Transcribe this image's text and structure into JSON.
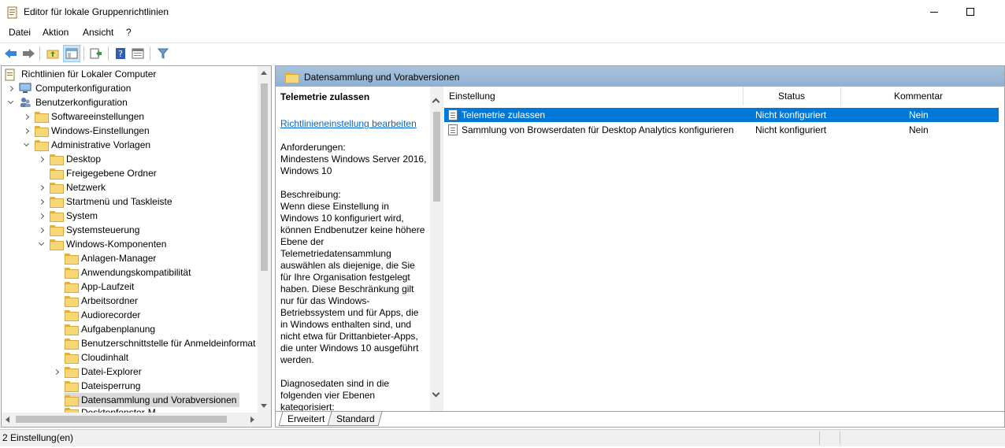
{
  "window": {
    "title": "Editor für lokale Gruppenrichtlinien"
  },
  "menu": [
    "Datei",
    "Aktion",
    "Ansicht",
    "?"
  ],
  "toolbar": {
    "buttons": [
      "back-icon",
      "forward-icon",
      "up-folder-icon",
      "show-hide-tree-icon",
      "export-list-icon",
      "help-icon",
      "properties-view-icon",
      "filter-icon"
    ]
  },
  "tree": {
    "root": "Richtlinien für Lokaler Computer",
    "items": [
      {
        "label": "Computerkonfiguration"
      },
      {
        "label": "Benutzerkonfiguration"
      },
      {
        "label": "Softwareeinstellungen"
      },
      {
        "label": "Windows-Einstellungen"
      },
      {
        "label": "Administrative Vorlagen"
      },
      {
        "label": "Desktop"
      },
      {
        "label": "Freigegebene Ordner"
      },
      {
        "label": "Netzwerk"
      },
      {
        "label": "Startmenü und Taskleiste"
      },
      {
        "label": "System"
      },
      {
        "label": "Systemsteuerung"
      },
      {
        "label": "Windows-Komponenten"
      },
      {
        "label": "Anlagen-Manager"
      },
      {
        "label": "Anwendungskompatibilität"
      },
      {
        "label": "App-Laufzeit"
      },
      {
        "label": "Arbeitsordner"
      },
      {
        "label": "Audiorecorder"
      },
      {
        "label": "Aufgabenplanung"
      },
      {
        "label": "Benutzerschnittstelle für Anmeldeinformat"
      },
      {
        "label": "Cloudinhalt"
      },
      {
        "label": "Datei-Explorer"
      },
      {
        "label": "Dateisperrung"
      },
      {
        "label": "Datensammlung und Vorabversionen"
      },
      {
        "label": "Desktopfenster-M"
      }
    ]
  },
  "right": {
    "header": "Datensammlung und Vorabversionen",
    "description": {
      "title": "Telemetrie zulassen",
      "link": "Richtlinieneinstellung bearbeiten",
      "requirements_label": "Anforderungen:",
      "requirements": "Mindestens Windows Server 2016, Windows 10",
      "description_label": "Beschreibung:",
      "description": "Wenn diese Einstellung in Windows 10 konfiguriert wird, können Endbenutzer keine höhere Ebene der Telemetriedatensammlung auswählen als diejenige, die Sie für Ihre Organisation festgelegt haben. Diese Beschränkung gilt nur für das Windows-Betriebssystem und für Apps, die in Windows enthalten sind, und nicht etwa für Drittanbieter-Apps, die unter Windows 10 ausgeführt werden.",
      "more": "Diagnosedaten sind in die folgenden vier Ebenen kategorisiert:"
    },
    "columns": [
      "Einstellung",
      "Status",
      "Kommentar"
    ],
    "rows": [
      {
        "setting": "Telemetrie zulassen",
        "status": "Nicht konfiguriert",
        "comment": "Nein"
      },
      {
        "setting": "Sammlung von Browserdaten für Desktop Analytics konfigurieren",
        "status": "Nicht konfiguriert",
        "comment": "Nein"
      }
    ],
    "tabs": [
      "Erweitert",
      "Standard"
    ]
  },
  "status": {
    "text": "2 Einstellung(en)"
  },
  "colors": {
    "selection": "#0078d7",
    "header_band": "#9cb9d7",
    "link": "#0066cc"
  }
}
